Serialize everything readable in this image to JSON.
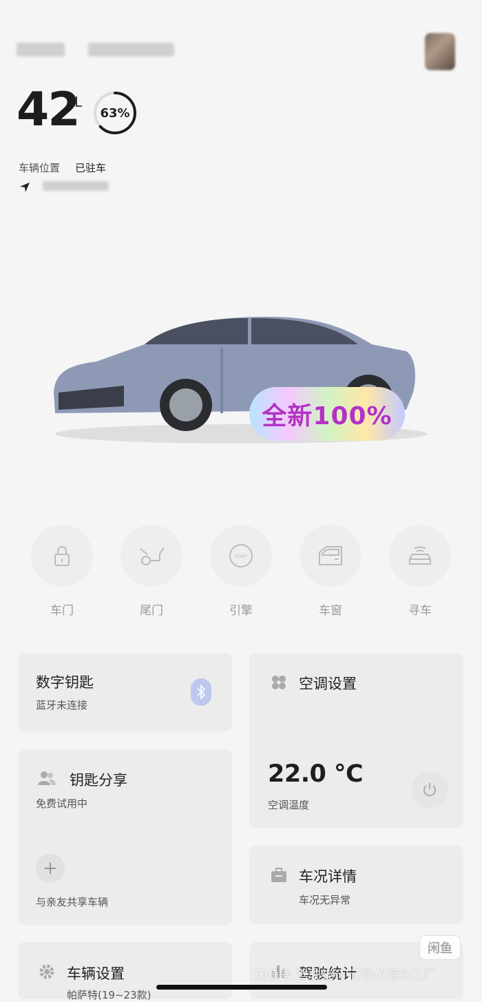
{
  "header": {
    "fuel_value": "42",
    "fuel_unit": "L",
    "fuel_percent_text": "63%",
    "fuel_percent": 0.63
  },
  "location": {
    "label": "车辆位置",
    "status": "已驻车"
  },
  "badge": {
    "text": "全新100%"
  },
  "controls": [
    {
      "label": "车门",
      "icon": "lock-icon"
    },
    {
      "label": "尾门",
      "icon": "trunk-icon"
    },
    {
      "label": "引擎",
      "icon": "engine-start-icon"
    },
    {
      "label": "车窗",
      "icon": "window-icon"
    },
    {
      "label": "寻车",
      "icon": "find-car-icon"
    }
  ],
  "cards": {
    "digital_key": {
      "title": "数字钥匙",
      "subtitle": "蓝牙未连接"
    },
    "ac": {
      "title": "空调设置",
      "temp": "22.0 °C",
      "temp_label": "空调温度"
    },
    "key_share": {
      "title": "钥匙分享",
      "subtitle": "免费试用中",
      "action": "与亲友共享车辆"
    },
    "vehicle_status": {
      "title": "车况详情",
      "subtitle": "车况无异常"
    },
    "vehicle_settings": {
      "title": "车辆设置",
      "subtitle": "帕萨特(19~23款)"
    },
    "driving_stats": {
      "title": "驾驶统计"
    }
  },
  "overlay": {
    "watermark": "闲鱼号  驾驶统计  记录仪源头工厂",
    "app_badge": "闲鱼"
  },
  "colors": {
    "background": "#f5f5f5",
    "card": "#ececec",
    "gauge": "#1d1d1d",
    "badge_text": "#b431c6",
    "bluetooth": "#bcc8ec"
  }
}
